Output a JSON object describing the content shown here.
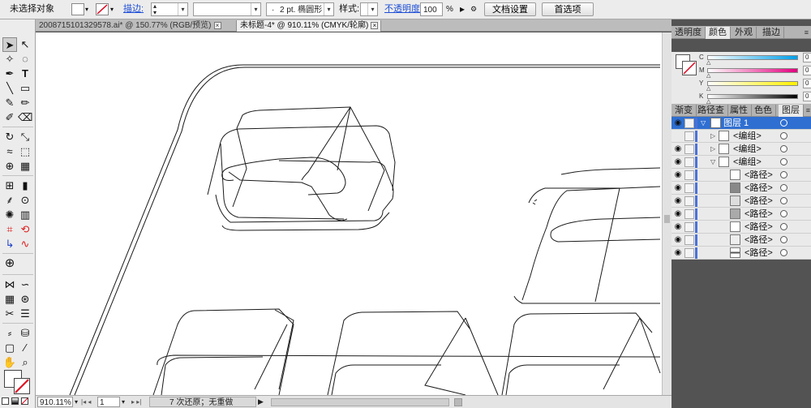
{
  "control_bar": {
    "selection_label": "未选择对象",
    "stroke_link": "描边:",
    "brush_value": "2 pt. 椭圆形",
    "style_label": "样式:",
    "opacity_link": "不透明度:",
    "opacity_value": "100",
    "opacity_unit": "%",
    "doc_setup_button": "文档设置",
    "preferences_button": "首选项"
  },
  "document_tabs": [
    {
      "label": "2008715101329578.ai* @ 150.77% (RGB/预览)",
      "active": false
    },
    {
      "label": "未标题-4* @ 910.11% (CMYK/轮廓)",
      "active": true
    }
  ],
  "status_bar": {
    "zoom": "910.11%",
    "page": "1",
    "undo_status": "7 次还原；无重做"
  },
  "color_panel": {
    "tabs": [
      "透明度",
      "颜色",
      "外观",
      "描边"
    ],
    "active_tab": "颜色",
    "channels": [
      {
        "label": "C",
        "value": "0",
        "unit": "%",
        "color": "#00a0e9"
      },
      {
        "label": "M",
        "value": "0",
        "unit": "%",
        "color": "#e4007f"
      },
      {
        "label": "Y",
        "value": "0",
        "unit": "%",
        "color": "#fff100"
      },
      {
        "label": "K",
        "value": "0",
        "unit": "%",
        "color": "#000000"
      }
    ]
  },
  "layers_panel": {
    "tabs": [
      "渐变",
      "路径查",
      "属性",
      "色色",
      "图层"
    ],
    "active_tab": "图层",
    "rows": [
      {
        "name": "图层 1",
        "level": 0,
        "visible": true,
        "expanded": true,
        "selected": true
      },
      {
        "name": "<编组>",
        "level": 1,
        "visible": false,
        "expanded": false,
        "selected": false
      },
      {
        "name": "<编组>",
        "level": 1,
        "visible": true,
        "expanded": false,
        "selected": false
      },
      {
        "name": "<编组>",
        "level": 1,
        "visible": true,
        "expanded": true,
        "selected": false
      },
      {
        "name": "<路径>",
        "level": 2,
        "visible": true,
        "selected": false
      },
      {
        "name": "<路径>",
        "level": 2,
        "visible": true,
        "selected": false
      },
      {
        "name": "<路径>",
        "level": 2,
        "visible": true,
        "selected": false
      },
      {
        "name": "<路径>",
        "level": 2,
        "visible": true,
        "selected": false
      },
      {
        "name": "<路径>",
        "level": 2,
        "visible": true,
        "selected": false
      },
      {
        "name": "<路径>",
        "level": 2,
        "visible": true,
        "selected": false
      },
      {
        "name": "<路径>",
        "level": 2,
        "visible": true,
        "selected": false
      }
    ]
  }
}
